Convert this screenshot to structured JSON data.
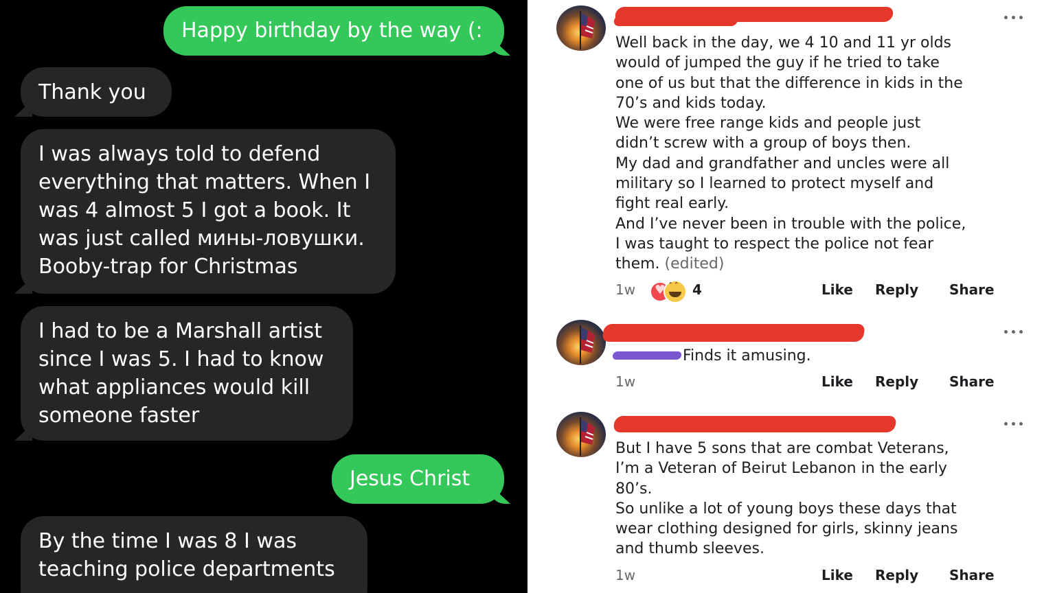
{
  "chat": {
    "messages": [
      {
        "direction": "sent",
        "text": "Happy birthday by the way (:"
      },
      {
        "direction": "received",
        "text": "Thank you"
      },
      {
        "direction": "received",
        "text": "I was always told to defend\neverything that matters. When I\nwas 4 almost 5 I got a book. It\nwas just called мины-ловушки.\nBooby-trap for Christmas"
      },
      {
        "direction": "received",
        "text": "I had to be a Marshall artist\nsince I was 5. I had to know\nwhat appliances would kill\nsomeone faster"
      },
      {
        "direction": "sent",
        "text": "Jesus Christ"
      },
      {
        "direction": "received",
        "text": "By the time I was 8 I was\nteaching police departments"
      }
    ],
    "colors": {
      "sent_bubble": "#34c759",
      "received_bubble": "#262628",
      "background": "#000000"
    }
  },
  "comments": [
    {
      "author_redacted": true,
      "avatar_icon": "american-flag-sunset-avatar",
      "text": "Well back in the day, we 4 10 and 11 yr olds\nwould of jumped the guy if he tried to take\none of us but that the difference in kids in the\n70’s and kids today.\nWe were free range kids and people just\ndidn’t screw with a group of boys then.\nMy dad and grandfather and uncles were all\nmilitary so I learned to protect myself and\nfight real early.\nAnd I’ve never been in trouble with the police,\nI was taught to respect the police not fear\nthem.",
      "edited_label": "(edited)",
      "time": "1w",
      "reaction_count": "4",
      "reaction_icons": [
        "heart-reaction-icon",
        "haha-reaction-icon"
      ],
      "like_label": "Like",
      "reply_label": "Reply",
      "share_label": "Share"
    },
    {
      "author_redacted": true,
      "avatar_icon": "american-flag-sunset-avatar",
      "text": "Finds it amusing.",
      "time": "1w",
      "like_label": "Like",
      "reply_label": "Reply",
      "share_label": "Share"
    },
    {
      "author_redacted": true,
      "avatar_icon": "american-flag-sunset-avatar",
      "text": "But I have 5 sons that are combat Veterans,\nI’m a Veteran of Beirut Lebanon in the early\n80’s.\nSo unlike a lot of young boys these days that\nwear clothing designed for girls, skinny jeans\nand thumb sleeves.",
      "time": "1w",
      "like_label": "Like",
      "reply_label": "Reply",
      "share_label": "Share"
    }
  ],
  "colors": {
    "redaction": "#e4382b",
    "redaction_alt": "#7a57d1",
    "secondary_text": "#65676b",
    "primary_text": "#1c1e21"
  }
}
